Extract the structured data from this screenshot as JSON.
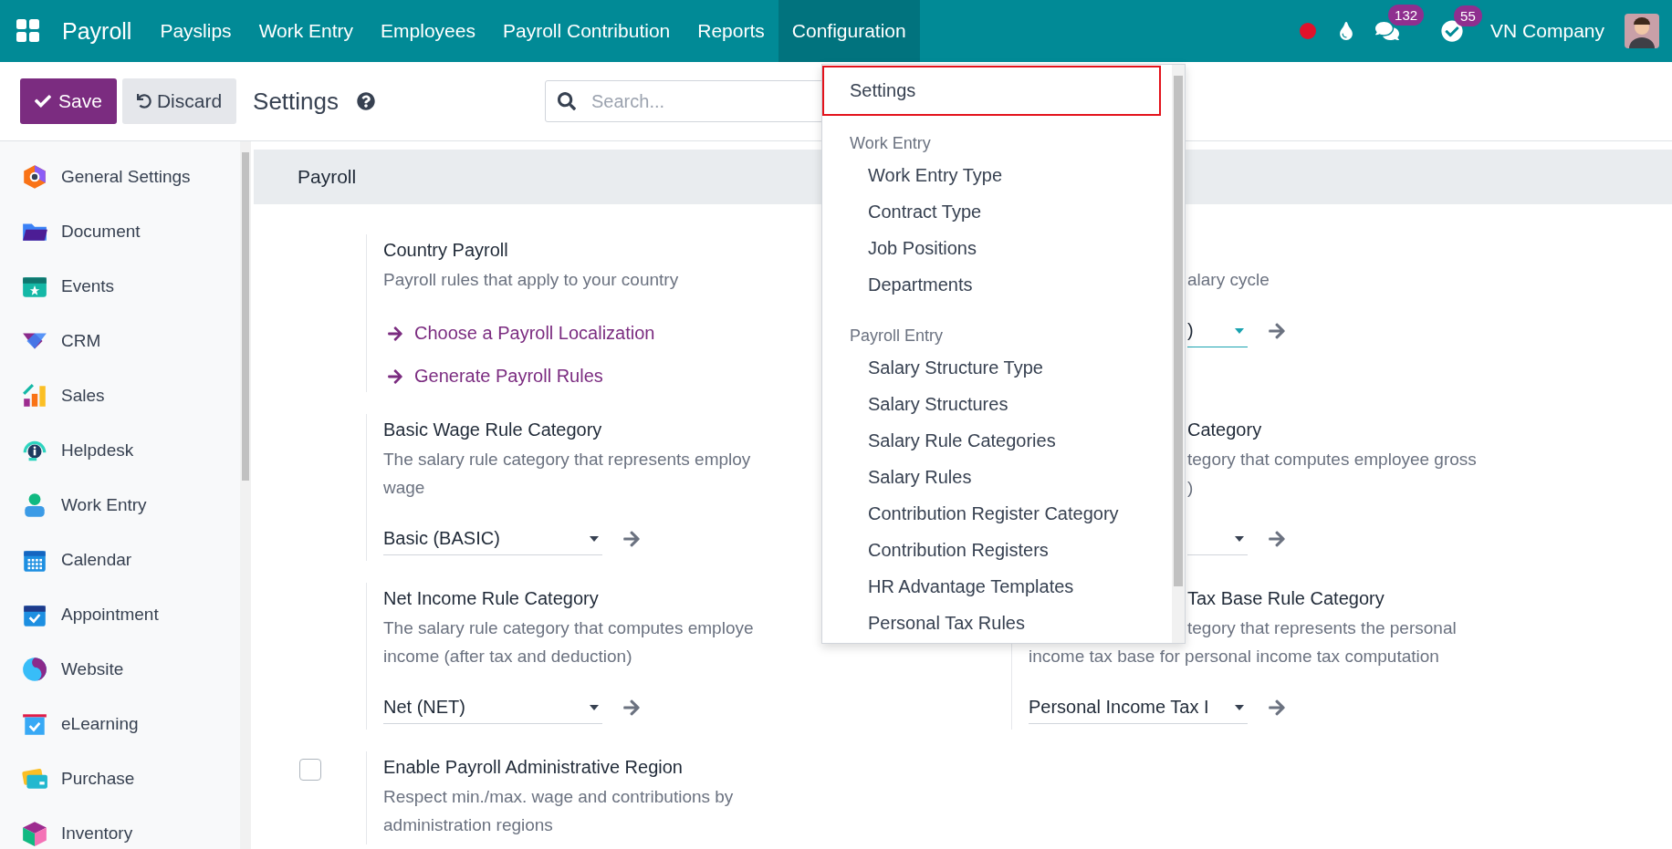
{
  "navbar": {
    "app_name": "Payroll",
    "menu": [
      {
        "label": "Payslips",
        "selected": false
      },
      {
        "label": "Work Entry",
        "selected": false
      },
      {
        "label": "Employees",
        "selected": false
      },
      {
        "label": "Payroll Contribution",
        "selected": false
      },
      {
        "label": "Reports",
        "selected": false
      },
      {
        "label": "Configuration",
        "selected": true
      }
    ],
    "message_count": "132",
    "activity_count": "55",
    "company": "VN Company"
  },
  "control_panel": {
    "save": "Save",
    "discard": "Discard",
    "title": "Settings",
    "search": {
      "placeholder": "Search..."
    }
  },
  "sidebar": {
    "items": [
      {
        "label": "General Settings"
      },
      {
        "label": "Document"
      },
      {
        "label": "Events"
      },
      {
        "label": "CRM"
      },
      {
        "label": "Sales"
      },
      {
        "label": "Helpdesk"
      },
      {
        "label": "Work Entry"
      },
      {
        "label": "Calendar"
      },
      {
        "label": "Appointment"
      },
      {
        "label": "Website"
      },
      {
        "label": "eLearning"
      },
      {
        "label": "Purchase"
      },
      {
        "label": "Inventory"
      }
    ]
  },
  "section": {
    "title": "Payroll"
  },
  "settings": [
    {
      "title": "Country Payroll",
      "description": "Payroll rules that apply to your country",
      "links": [
        "Choose a Payroll Localization",
        "Generate Payroll Rules"
      ]
    },
    {
      "description_lines": [
        {
          "text": "alary cycle",
          "covered": true
        }
      ],
      "select": {
        "value": ")",
        "focused": true,
        "covered": true
      }
    },
    {
      "title": "Basic Wage Rule Category",
      "description": "The salary rule category that represents employ\nwage",
      "select": {
        "value": "Basic (BASIC)",
        "focused": false,
        "covered": false
      }
    },
    {
      "title": "Category",
      "title_covered": true,
      "description_lines": [
        {
          "text": "tegory that computes employee gross",
          "covered": true
        },
        {
          "text": ")",
          "covered": true
        }
      ],
      "select": {
        "focused": false,
        "covered": true
      }
    },
    {
      "title": "Net Income Rule Category",
      "description": "The salary rule category that computes employe\nincome (after tax and deduction)",
      "select": {
        "value": "Net (NET)",
        "focused": false,
        "covered": false
      }
    },
    {
      "title": "Tax Base Rule Category",
      "title_covered": true,
      "description_lines": [
        {
          "text": "tegory that represents the personal",
          "covered": true
        },
        {
          "text": "income tax base for personal income tax computation",
          "covered": false
        }
      ],
      "select": {
        "value": "Personal Income Tax I",
        "focused": false,
        "covered": false
      }
    },
    {
      "title": "Enable Payroll Administrative Region",
      "description": "Respect min./max. wage and contributions by\nadministration regions",
      "checkbox": {
        "checked": false
      }
    }
  ],
  "dropdown": {
    "items": [
      {
        "kind": "item",
        "label": "Settings",
        "highlighted": true
      },
      {
        "kind": "group",
        "label": "Work Entry",
        "children": [
          {
            "label": "Work Entry Type",
            "highlighted": false
          },
          {
            "label": "Contract Type",
            "highlighted": false
          },
          {
            "label": "Job Positions",
            "highlighted": false
          },
          {
            "label": "Departments",
            "highlighted": false
          }
        ]
      },
      {
        "kind": "group",
        "label": "Payroll Entry",
        "children": [
          {
            "label": "Salary Structure Type",
            "highlighted": false
          },
          {
            "label": "Salary Structures",
            "highlighted": false
          },
          {
            "label": "Salary Rule Categories",
            "highlighted": false
          },
          {
            "label": "Salary Rules",
            "highlighted": false
          },
          {
            "label": "Contribution Register Category",
            "highlighted": false
          },
          {
            "label": "Contribution Registers",
            "highlighted": false
          },
          {
            "label": "HR Advantage Templates",
            "highlighted": false
          },
          {
            "label": "Personal Tax Rules",
            "highlighted": false
          }
        ]
      }
    ]
  }
}
